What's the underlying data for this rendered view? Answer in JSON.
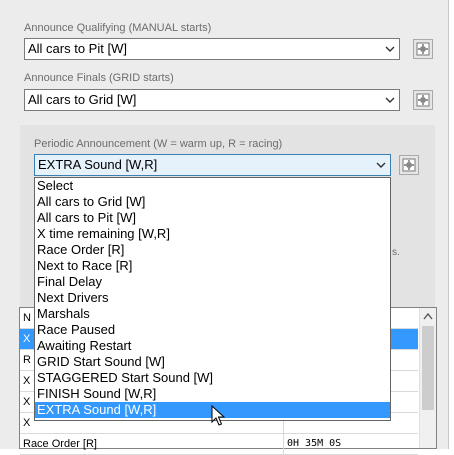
{
  "qualifying": {
    "label": "Announce Qualifying (MANUAL starts)",
    "value": "All cars to Pit [W]",
    "button_icon": "announce-settings-icon"
  },
  "finals": {
    "label": "Announce Finals (GRID starts)",
    "value": "All cars to Grid [W]",
    "button_icon": "announce-settings-icon"
  },
  "periodic": {
    "label": "Periodic Announcement (W = warm up, R = racing)",
    "value": "EXTRA Sound [W,R]",
    "hint": "s.",
    "options": [
      "Select",
      "All cars to Grid [W]",
      "All cars to Pit [W]",
      "X time remaining [W,R]",
      "Race Order [R]",
      "Next to Race [R]",
      "Final Delay",
      "Next Drivers",
      "Marshals",
      "Race Paused",
      "Awaiting Restart",
      "GRID Start Sound [W]",
      "STAGGERED Start Sound [W]",
      "FINISH Sound [W,R]",
      "EXTRA Sound [W,R]"
    ],
    "selected_index": 14
  },
  "table": {
    "rows": [
      {
        "col1": "N",
        "col2": "",
        "highlight": false
      },
      {
        "col1": "X",
        "col2": "",
        "highlight": true
      },
      {
        "col1": "R",
        "col2": "",
        "highlight": false
      },
      {
        "col1": "X",
        "col2": "",
        "highlight": false
      },
      {
        "col1": "X",
        "col2": "",
        "highlight": false
      },
      {
        "col1": "X",
        "col2": "",
        "highlight": false
      },
      {
        "col1": "Race Order [R]",
        "col2": "0H 35M 0S",
        "highlight": false
      }
    ]
  },
  "colors": {
    "selection": "#3399ff",
    "panel": "#ececec"
  }
}
